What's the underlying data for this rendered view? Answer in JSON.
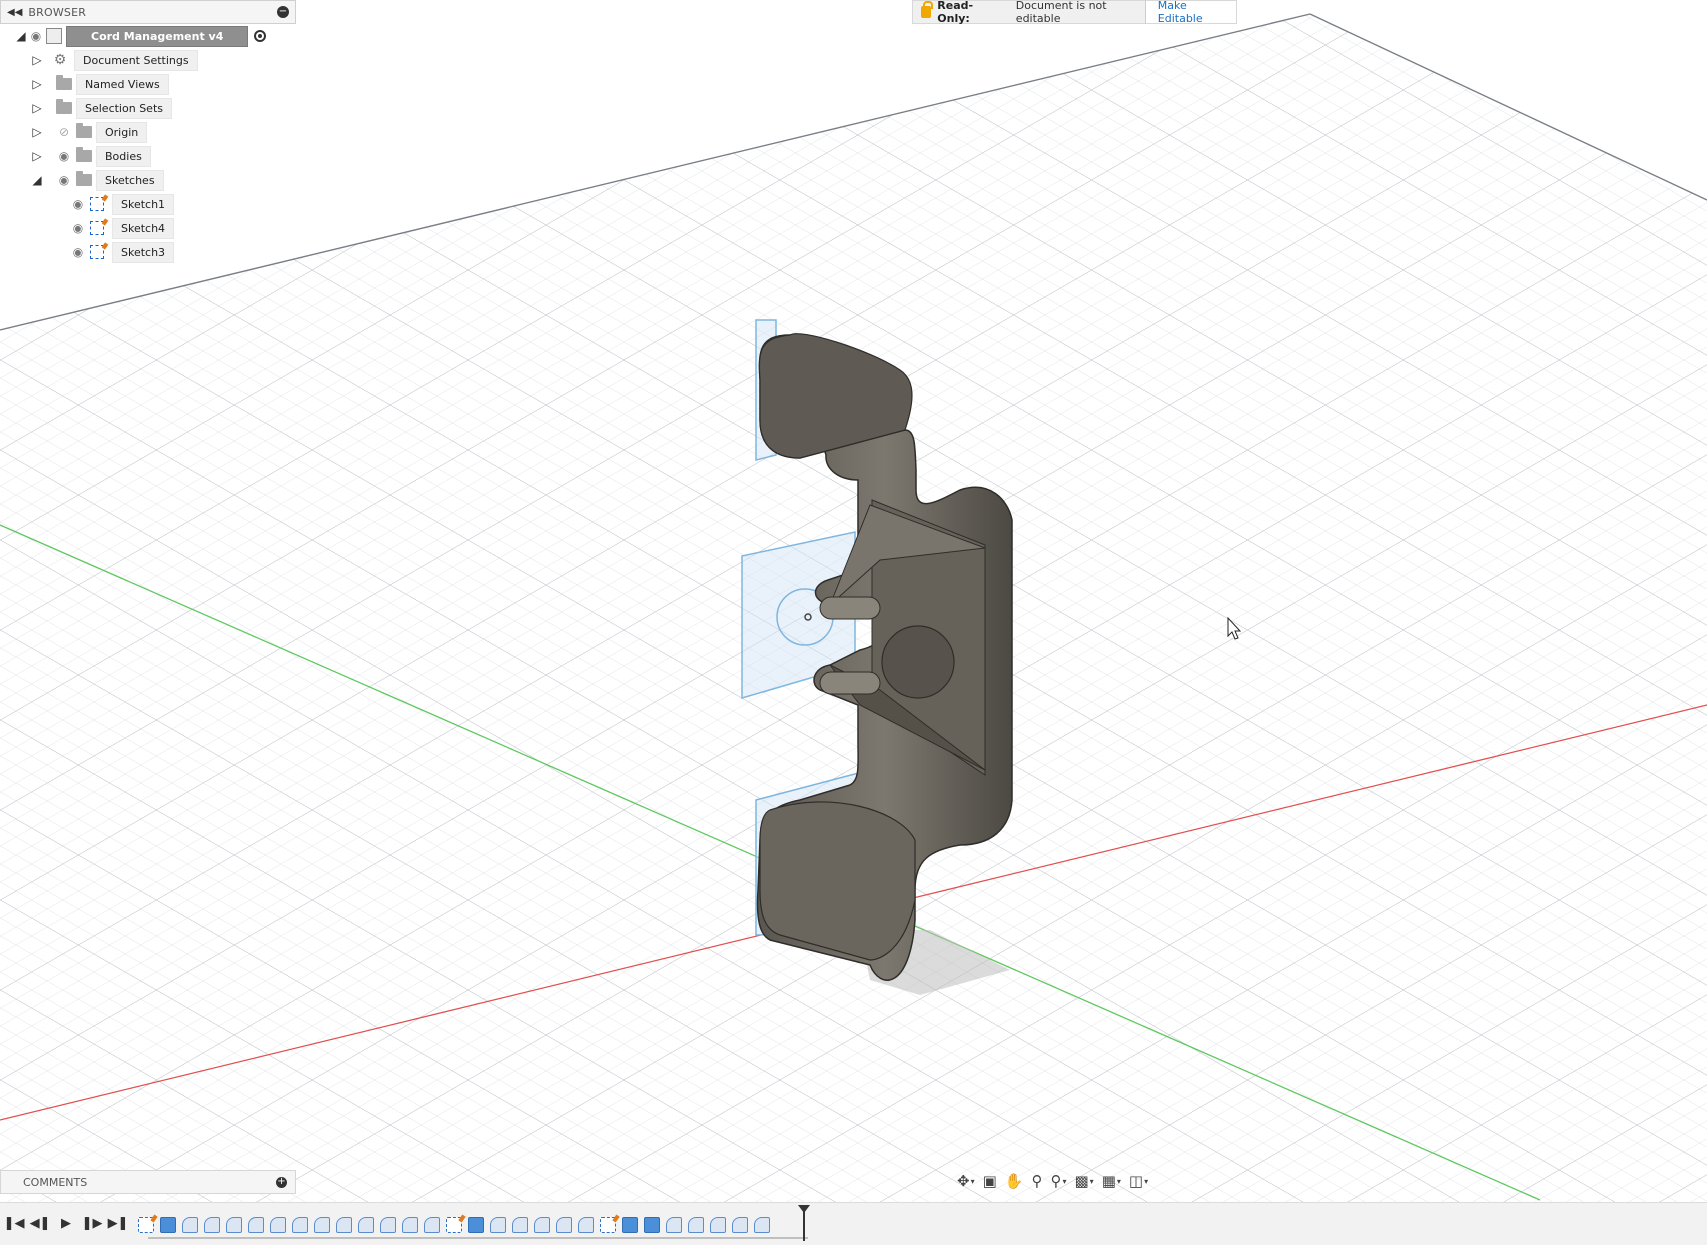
{
  "browser": {
    "title": "BROWSER",
    "collapse_icon": "collapse-panel-icon",
    "root": {
      "label": "Cord Management v4"
    },
    "items": [
      {
        "label": "Document Settings",
        "icon": "gear-icon"
      },
      {
        "label": "Named Views",
        "icon": "folder-icon"
      },
      {
        "label": "Selection Sets",
        "icon": "folder-icon"
      },
      {
        "label": "Origin",
        "icon": "folder-icon",
        "visibility": "hidden"
      },
      {
        "label": "Bodies",
        "icon": "folder-icon"
      },
      {
        "label": "Sketches",
        "icon": "folder-icon",
        "expanded": true
      }
    ],
    "sketches": [
      {
        "label": "Sketch1"
      },
      {
        "label": "Sketch4"
      },
      {
        "label": "Sketch3"
      }
    ]
  },
  "readonly": {
    "label": "Read-Only:",
    "message": "Document is not editable",
    "action": "Make Editable"
  },
  "comments": {
    "title": "COMMENTS"
  },
  "nav_toolbar": {
    "buttons": [
      "orbit-icon",
      "look-at-icon",
      "pan-icon",
      "zoom-icon",
      "zoom-window-icon",
      "display-settings-icon",
      "grid-icon",
      "viewports-icon"
    ]
  },
  "timeline": {
    "playback": [
      "go-to-start-icon",
      "step-back-icon",
      "play-icon",
      "step-forward-icon",
      "go-to-end-icon"
    ],
    "features": [
      "sketch",
      "extrude",
      "fillet",
      "fillet",
      "fillet",
      "fillet",
      "fillet",
      "fillet",
      "fillet",
      "fillet",
      "fillet",
      "fillet",
      "fillet",
      "fillet",
      "sketch",
      "extrude",
      "fillet",
      "fillet",
      "fillet",
      "fillet",
      "fillet",
      "sketch",
      "extrude",
      "extrude",
      "fillet",
      "fillet",
      "fillet",
      "fillet",
      "fillet"
    ]
  },
  "colors": {
    "x_axis": "#e05050",
    "y_axis": "#5fc85f",
    "sketch_plane": "#7fb6e0",
    "body": "#6f6b63"
  }
}
